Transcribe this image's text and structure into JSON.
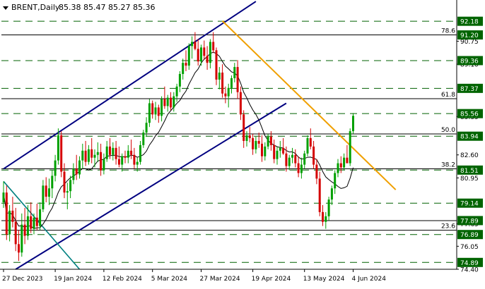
{
  "chart_data": {
    "type": "candlestick",
    "title": "BRENT,Daily",
    "ohlc_header": "85.38 85.47 85.27 85.36",
    "colors": {
      "up": "#00a000",
      "down": "#d40000",
      "channel": "#000080",
      "resistance_trendline": "#f0a000",
      "teal_trendline": "#008080",
      "ma": "#000000",
      "dashed_level": "#006000",
      "price_badge": "#006400"
    },
    "y_axis": {
      "range": [
        74.4,
        93.3
      ],
      "tick_labels": [
        "92.18",
        "91.20",
        "90.75",
        "89.36",
        "89.10",
        "87.37",
        "85.56",
        "85.35",
        "83.94",
        "82.60",
        "81.51",
        "80.95",
        "79.14",
        "77.89",
        "77.65",
        "76.89",
        "76.05",
        "74.89",
        "74.40"
      ],
      "grey_ticks": [
        90.75,
        89.1,
        85.35,
        82.6,
        80.95,
        77.65,
        76.05,
        74.4
      ],
      "badges": [
        92.18,
        91.2,
        89.36,
        87.37,
        85.56,
        83.94,
        81.51,
        79.14,
        77.89,
        76.89,
        74.89
      ]
    },
    "x_axis": {
      "tick_labels": [
        "27 Dec 2023",
        "19 Jan 2024",
        "12 Feb 2024",
        "5 Mar 2024",
        "27 Mar 2024",
        "19 Apr 2024",
        "13 May 2024",
        "4 Jun 2024"
      ],
      "tick_bars": [
        0,
        17,
        33,
        49,
        65,
        82,
        99,
        115
      ]
    },
    "horizontal_levels": [
      {
        "price": 92.18,
        "style": "dashed"
      },
      {
        "price": 91.2,
        "style": "solid",
        "label": "78.6"
      },
      {
        "price": 89.36,
        "style": "dashed"
      },
      {
        "price": 87.37,
        "style": "dashed"
      },
      {
        "price": 86.63,
        "style": "solid",
        "label": "61.8"
      },
      {
        "price": 85.56,
        "style": "dashed"
      },
      {
        "price": 84.1,
        "style": "solid",
        "label": "50.0"
      },
      {
        "price": 83.94,
        "style": "dashed"
      },
      {
        "price": 81.6,
        "style": "solid",
        "label": "38.2"
      },
      {
        "price": 81.51,
        "style": "dashed"
      },
      {
        "price": 79.14,
        "style": "dashed"
      },
      {
        "price": 77.89,
        "style": "solid"
      },
      {
        "price": 77.2,
        "style": "solid",
        "label": "23.6"
      },
      {
        "price": 76.89,
        "style": "dashed"
      },
      {
        "price": 74.89,
        "style": "dashed"
      }
    ],
    "trendlines": [
      {
        "name": "channel-upper",
        "points": [
          [
            0,
            81.6
          ],
          [
            83,
            93.6
          ]
        ]
      },
      {
        "name": "channel-lower",
        "points": [
          [
            4,
            74.4
          ],
          [
            93,
            86.3
          ]
        ]
      },
      {
        "name": "resistance-line",
        "points": [
          [
            72,
            92.2
          ],
          [
            129,
            80.1
          ]
        ]
      },
      {
        "name": "teal-line",
        "points": [
          [
            0,
            80.7
          ],
          [
            25,
            74.4
          ]
        ]
      }
    ],
    "ohlc": [
      [
        79.2,
        80.7,
        78.8,
        79.9
      ],
      [
        79.9,
        80.4,
        76.5,
        76.9
      ],
      [
        76.9,
        79.0,
        76.4,
        78.6
      ],
      [
        78.6,
        79.6,
        77.4,
        77.8
      ],
      [
        77.8,
        78.8,
        75.7,
        76.2
      ],
      [
        76.2,
        77.2,
        75.0,
        75.6
      ],
      [
        75.6,
        78.4,
        75.3,
        77.6
      ],
      [
        77.6,
        78.8,
        76.2,
        76.8
      ],
      [
        76.8,
        79.0,
        76.5,
        78.2
      ],
      [
        78.2,
        79.2,
        77.0,
        77.3
      ],
      [
        77.3,
        78.4,
        76.9,
        78.1
      ],
      [
        78.1,
        79.1,
        77.2,
        77.5
      ],
      [
        77.5,
        79.2,
        77.2,
        78.7
      ],
      [
        78.7,
        80.8,
        78.5,
        80.4
      ],
      [
        80.4,
        81.0,
        79.2,
        79.6
      ],
      [
        79.6,
        80.9,
        79.0,
        80.2
      ],
      [
        80.2,
        81.5,
        79.5,
        81.1
      ],
      [
        81.1,
        82.6,
        80.7,
        82.2
      ],
      [
        82.2,
        84.5,
        81.9,
        84.0
      ],
      [
        84.0,
        84.3,
        81.0,
        81.4
      ],
      [
        81.4,
        82.0,
        79.5,
        79.9
      ],
      [
        79.9,
        80.6,
        78.7,
        80.0
      ],
      [
        80.0,
        81.1,
        79.5,
        80.8
      ],
      [
        80.8,
        82.0,
        80.5,
        81.6
      ],
      [
        81.6,
        82.6,
        80.8,
        81.2
      ],
      [
        81.2,
        82.5,
        80.9,
        82.2
      ],
      [
        82.2,
        83.4,
        81.6,
        82.9
      ],
      [
        82.9,
        83.6,
        81.8,
        82.1
      ],
      [
        82.1,
        83.3,
        81.9,
        83.0
      ],
      [
        83.0,
        83.8,
        82.0,
        82.4
      ],
      [
        82.4,
        83.0,
        81.7,
        82.6
      ],
      [
        82.6,
        83.5,
        82.1,
        82.8
      ],
      [
        82.8,
        83.4,
        81.1,
        81.5
      ],
      [
        81.5,
        82.7,
        81.2,
        82.3
      ],
      [
        82.3,
        83.6,
        82.1,
        83.2
      ],
      [
        83.2,
        83.8,
        82.3,
        82.6
      ],
      [
        82.6,
        83.5,
        82.2,
        83.1
      ],
      [
        83.1,
        83.6,
        81.9,
        82.3
      ],
      [
        82.3,
        83.2,
        81.7,
        81.9
      ],
      [
        81.9,
        82.7,
        81.4,
        82.5
      ],
      [
        82.5,
        82.9,
        82.0,
        82.4
      ],
      [
        82.4,
        83.3,
        82.0,
        82.9
      ],
      [
        82.9,
        83.7,
        82.3,
        82.6
      ],
      [
        82.6,
        83.1,
        81.6,
        81.9
      ],
      [
        81.9,
        82.4,
        81.4,
        82.1
      ],
      [
        82.1,
        83.6,
        81.9,
        83.3
      ],
      [
        83.3,
        84.4,
        83.1,
        84.2
      ],
      [
        84.2,
        85.3,
        83.9,
        84.9
      ],
      [
        84.9,
        86.6,
        84.6,
        86.3
      ],
      [
        86.3,
        86.5,
        85.2,
        85.5
      ],
      [
        85.5,
        86.4,
        85.1,
        86.0
      ],
      [
        86.0,
        86.2,
        84.9,
        85.4
      ],
      [
        85.4,
        86.8,
        85.0,
        86.6
      ],
      [
        86.6,
        87.5,
        85.9,
        86.1
      ],
      [
        86.1,
        86.9,
        85.7,
        86.7
      ],
      [
        86.7,
        87.1,
        85.8,
        86.0
      ],
      [
        86.0,
        87.1,
        85.7,
        86.8
      ],
      [
        86.8,
        87.7,
        86.4,
        87.5
      ],
      [
        87.5,
        88.6,
        87.1,
        88.4
      ],
      [
        88.4,
        89.5,
        88.0,
        89.2
      ],
      [
        89.2,
        90.1,
        88.6,
        89.0
      ],
      [
        89.0,
        90.6,
        88.7,
        90.4
      ],
      [
        90.4,
        91.1,
        89.5,
        90.7
      ],
      [
        90.7,
        91.4,
        90.1,
        90.2
      ],
      [
        90.2,
        90.9,
        89.0,
        89.3
      ],
      [
        89.3,
        90.5,
        89.0,
        90.3
      ],
      [
        90.3,
        90.8,
        89.4,
        89.7
      ],
      [
        89.7,
        90.4,
        88.7,
        89.2
      ],
      [
        89.2,
        90.9,
        88.8,
        90.7
      ],
      [
        90.7,
        91.4,
        89.9,
        90.1
      ],
      [
        90.1,
        90.3,
        87.6,
        88.0
      ],
      [
        88.0,
        88.9,
        87.3,
        88.5
      ],
      [
        88.5,
        89.1,
        86.7,
        87.0
      ],
      [
        87.0,
        87.5,
        86.3,
        86.8
      ],
      [
        86.8,
        87.7,
        86.0,
        87.4
      ],
      [
        87.4,
        88.3,
        87.0,
        88.1
      ],
      [
        88.1,
        89.2,
        87.8,
        88.9
      ],
      [
        88.9,
        89.4,
        86.6,
        87.1
      ],
      [
        87.1,
        87.5,
        85.1,
        85.5
      ],
      [
        85.5,
        85.8,
        83.1,
        83.6
      ],
      [
        83.6,
        84.3,
        83.2,
        84.0
      ],
      [
        84.0,
        84.6,
        83.5,
        83.8
      ],
      [
        83.8,
        84.1,
        82.6,
        83.0
      ],
      [
        83.0,
        83.9,
        82.7,
        83.6
      ],
      [
        83.6,
        84.2,
        83.1,
        83.4
      ],
      [
        83.4,
        84.0,
        82.1,
        82.5
      ],
      [
        82.5,
        83.5,
        82.2,
        83.2
      ],
      [
        83.2,
        84.1,
        83.0,
        83.9
      ],
      [
        83.9,
        84.3,
        82.9,
        83.3
      ],
      [
        83.3,
        83.7,
        82.0,
        82.3
      ],
      [
        82.3,
        83.2,
        81.9,
        82.9
      ],
      [
        82.9,
        83.6,
        82.4,
        83.1
      ],
      [
        83.1,
        83.8,
        82.6,
        82.7
      ],
      [
        82.7,
        83.2,
        81.4,
        81.8
      ],
      [
        81.8,
        82.6,
        81.5,
        82.4
      ],
      [
        82.4,
        83.1,
        82.0,
        82.6
      ],
      [
        82.6,
        83.0,
        81.7,
        82.0
      ],
      [
        82.0,
        82.5,
        81.0,
        81.3
      ],
      [
        81.3,
        82.4,
        80.9,
        81.9
      ],
      [
        81.9,
        82.9,
        81.6,
        82.7
      ],
      [
        82.7,
        84.0,
        82.5,
        83.8
      ],
      [
        83.8,
        84.5,
        83.0,
        83.2
      ],
      [
        83.2,
        83.6,
        81.6,
        81.9
      ],
      [
        81.9,
        82.3,
        80.5,
        80.9
      ],
      [
        80.9,
        81.4,
        78.2,
        78.5
      ],
      [
        78.5,
        79.0,
        77.5,
        77.8
      ],
      [
        77.8,
        78.5,
        77.3,
        78.2
      ],
      [
        78.2,
        79.6,
        77.9,
        79.4
      ],
      [
        79.4,
        80.4,
        79.0,
        80.2
      ],
      [
        80.2,
        81.5,
        79.8,
        81.3
      ],
      [
        81.3,
        82.3,
        81.0,
        82.0
      ],
      [
        82.0,
        82.5,
        81.3,
        81.7
      ],
      [
        81.7,
        82.7,
        81.5,
        82.4
      ],
      [
        82.4,
        83.3,
        82.1,
        82.0
      ],
      [
        82.0,
        84.5,
        81.8,
        84.3
      ],
      [
        84.3,
        85.6,
        84.1,
        85.4
      ]
    ]
  }
}
